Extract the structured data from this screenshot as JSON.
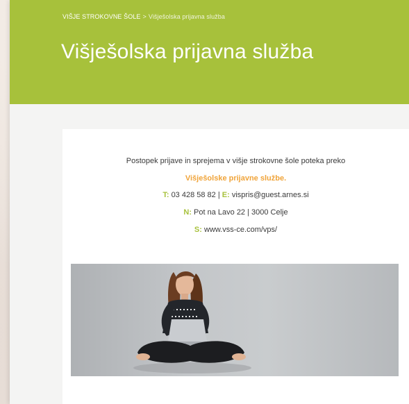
{
  "header": {
    "breadcrumb": {
      "parent": "VIŠJE STROKOVNE ŠOLE",
      "separator": ">",
      "current": "Višješolska prijavna služba"
    },
    "title": "Višješolska prijavna služba"
  },
  "content": {
    "intro": "Postopek prijave in sprejema v višje strokovne šole poteka preko",
    "highlight": "Višješolske prijavne službe.",
    "phone_key": "T:",
    "phone": "03 428 58 82",
    "divider": "|",
    "email_key": "E:",
    "email": "vispris@guest.arnes.si",
    "address_key": "N:",
    "address": "Pot na Lavo 22 | 3000 Celje",
    "site_key": "S:",
    "site": "www.vss-ce.com/vps/"
  },
  "colors": {
    "header_green": "#a7c13b",
    "highlight_orange": "#f0a43a",
    "key_green": "#a7c13b"
  }
}
